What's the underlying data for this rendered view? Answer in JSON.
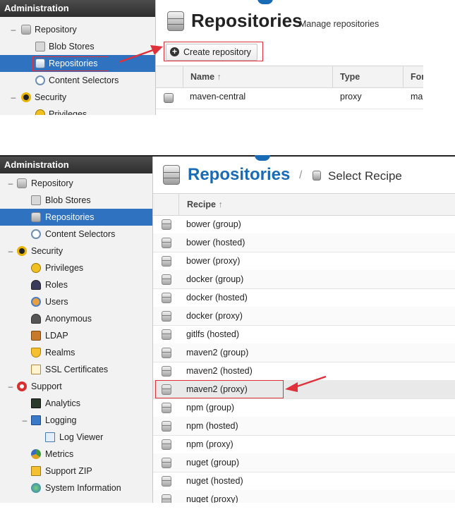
{
  "panel1": {
    "sidebar": {
      "header": "Administration",
      "items": [
        {
          "label": "Repository",
          "toggle": "–",
          "icon": "database-icon"
        },
        {
          "label": "Blob Stores",
          "icon": "hard-drive-icon"
        },
        {
          "label": "Repositories",
          "icon": "database-icon",
          "selected": true
        },
        {
          "label": "Content Selectors",
          "icon": "selector-icon"
        },
        {
          "label": "Security",
          "toggle": "–",
          "icon": "police-hat-icon"
        },
        {
          "label": "Privileges",
          "icon": "medal-icon"
        }
      ]
    },
    "main": {
      "title": "Repositories",
      "subtitle": "Manage repositories",
      "create_button": "Create repository",
      "columns": [
        "Name",
        "Type",
        "For"
      ],
      "rows": [
        {
          "name": "maven-central",
          "type": "proxy",
          "format": "ma"
        }
      ]
    }
  },
  "panel2": {
    "sidebar": {
      "header": "Administration",
      "items": [
        {
          "label": "Repository",
          "toggle": "–",
          "icon": "database-icon"
        },
        {
          "label": "Blob Stores",
          "icon": "hard-drive-icon"
        },
        {
          "label": "Repositories",
          "icon": "database-icon",
          "selected": true
        },
        {
          "label": "Content Selectors",
          "icon": "selector-icon"
        },
        {
          "label": "Security",
          "toggle": "–",
          "icon": "police-hat-icon"
        },
        {
          "label": "Privileges",
          "icon": "medal-icon"
        },
        {
          "label": "Roles",
          "icon": "user-badge-icon"
        },
        {
          "label": "Users",
          "icon": "users-icon"
        },
        {
          "label": "Anonymous",
          "icon": "anonymous-user-icon"
        },
        {
          "label": "LDAP",
          "icon": "address-book-icon"
        },
        {
          "label": "Realms",
          "icon": "shield-icon"
        },
        {
          "label": "SSL Certificates",
          "icon": "certificate-icon"
        },
        {
          "label": "Support",
          "toggle": "–",
          "icon": "lifebuoy-icon"
        },
        {
          "label": "Analytics",
          "icon": "chart-monitor-icon"
        },
        {
          "label": "Logging",
          "toggle": "–",
          "icon": "book-icon"
        },
        {
          "label": "Log Viewer",
          "icon": "log-file-icon"
        },
        {
          "label": "Metrics",
          "icon": "pie-chart-icon"
        },
        {
          "label": "Support ZIP",
          "icon": "zip-icon"
        },
        {
          "label": "System Information",
          "icon": "globe-icon"
        }
      ]
    },
    "main": {
      "breadcrumb_title": "Repositories",
      "breadcrumb_separator": "/",
      "breadcrumb_current": "Select Recipe",
      "column": "Recipe",
      "sort_indicator": "↑",
      "recipes": [
        "bower (group)",
        "bower (hosted)",
        "bower (proxy)",
        "docker (group)",
        "docker (hosted)",
        "docker (proxy)",
        "gitlfs (hosted)",
        "maven2 (group)",
        "maven2 (hosted)",
        "maven2 (proxy)",
        "npm (group)",
        "npm (hosted)",
        "npm (proxy)",
        "nuget (group)",
        "nuget (hosted)",
        "nuget (proxy)"
      ],
      "selected_recipe": "maven2 (proxy)"
    }
  },
  "colors": {
    "header_dark": "#333333",
    "selection_blue": "#2e72c0",
    "title_blue": "#1a6bb5",
    "highlight_red": "#e0303a"
  }
}
